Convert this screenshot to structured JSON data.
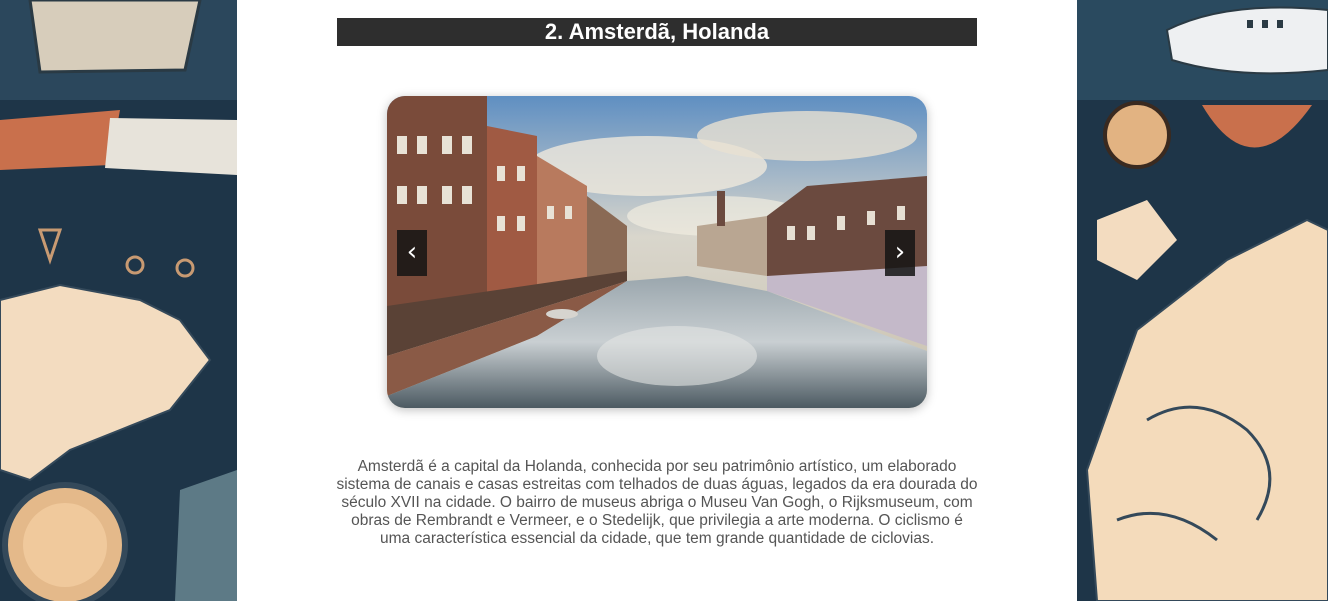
{
  "section": {
    "title": "2. Amsterdã, Holanda",
    "description": "Amsterdã é a capital da Holanda, conhecida por seu patrimônio artístico, um elaborado sistema de canais e casas estreitas com telhados de duas águas, legados da era dourada do século XVII na cidade. O bairro de museus abriga o Museu Van Gogh, o Rijksmuseum, com obras de Rembrandt e Vermeer, e o Stedelijk, que privilegia a arte moderna. O ciclismo é uma característica essencial da cidade, que tem grande quantidade de ciclovias."
  },
  "carousel": {
    "prev_label": "‹",
    "next_label": "›",
    "image_icon": "amsterdam-canal-photo"
  },
  "colors": {
    "title_background": "#2e2e2e",
    "title_text": "#ffffff",
    "body_text": "#555555",
    "page_background": "#ffffff"
  }
}
